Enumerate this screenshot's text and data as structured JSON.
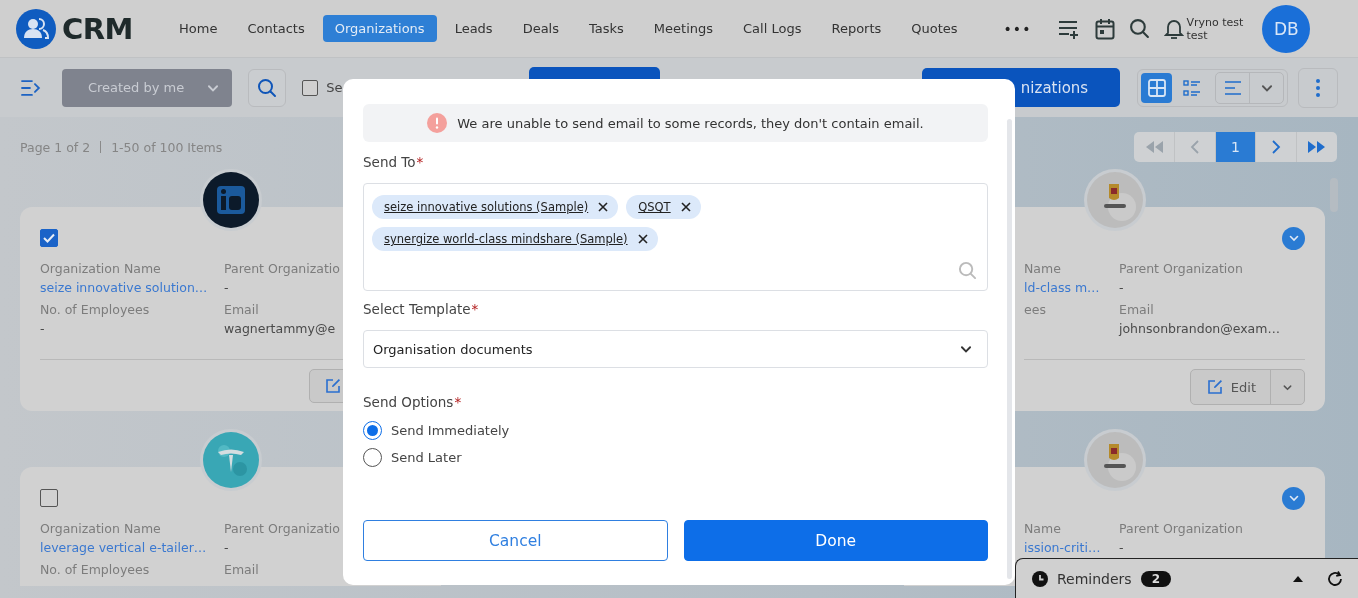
{
  "header": {
    "logo": "CRM",
    "nav": [
      {
        "label": "Home",
        "selected": false
      },
      {
        "label": "Contacts",
        "selected": false
      },
      {
        "label": "Organizations",
        "selected": true
      },
      {
        "label": "Leads",
        "selected": false
      },
      {
        "label": "Deals",
        "selected": false
      },
      {
        "label": "Tasks",
        "selected": false
      },
      {
        "label": "Meetings",
        "selected": false
      },
      {
        "label": "Call Logs",
        "selected": false
      },
      {
        "label": "Reports",
        "selected": false
      },
      {
        "label": "Quotes",
        "selected": false
      }
    ],
    "more": "•••",
    "user": {
      "name": "Vryno test test",
      "initials": "DB"
    }
  },
  "toolbar": {
    "filter": "Created by me",
    "select_all": {
      "label": "Se",
      "checked": false
    },
    "primary_button": "nizations",
    "views": [
      {
        "kind": "grid",
        "selected": true
      },
      {
        "kind": "list",
        "selected": false
      }
    ]
  },
  "summary": {
    "page": "Page 1 of 2",
    "range": "1-50 of 100 Items"
  },
  "pagination": {
    "pages": [
      {
        "label": "1",
        "selected": true
      }
    ]
  },
  "cards": [
    {
      "kind": "selectable",
      "checked": true,
      "footer": true,
      "fields": [
        {
          "label": "Organization Name",
          "value": "seize innovative solution…",
          "link": true
        },
        {
          "label": "Parent Organizatio",
          "value": "-",
          "link": false
        },
        {
          "label": "No. of Employees",
          "value": "-",
          "link": false
        },
        {
          "label": "Email",
          "value": "wagnertammy@e",
          "link": false
        }
      ]
    },
    {
      "kind": "expandable",
      "footer": true,
      "action": "Edit",
      "fields": [
        {
          "label": "Name",
          "value": "ld-class m…",
          "link": true
        },
        {
          "label": "Parent Organization",
          "value": "-",
          "link": false
        },
        {
          "label": "ees"
        },
        {
          "label": "Email",
          "value": "johnsonbrandon@exam…",
          "link": false
        }
      ]
    },
    {
      "kind": "selectable",
      "checked": false,
      "fields": [
        {
          "label": "Organization Name",
          "value": "leverage vertical e-tailer…",
          "link": true
        },
        {
          "label": "Parent Organizatio",
          "value": "-",
          "link": false
        },
        {
          "label": "No. of Employees"
        },
        {
          "label": "Email"
        }
      ]
    },
    {
      "kind": "expandable",
      "fields": [
        {
          "label": "Name",
          "value": "ission-criti…",
          "link": true
        },
        {
          "label": "Parent Organization",
          "value": "-",
          "link": false
        }
      ]
    }
  ],
  "dialog": {
    "alert": "We are unable to send email to some records, they don't contain email.",
    "fields": [
      {
        "kind": "recipients",
        "label": "Send To",
        "required_mark": "*",
        "tags": [
          "seize innovative solutions (Sample)",
          "QSQT",
          "synergize world-class mindshare (Sample)"
        ]
      },
      {
        "kind": "select",
        "label": "Select Template",
        "required_mark": "*",
        "value": "Organisation documents"
      },
      {
        "kind": "radio",
        "label": "Send Options",
        "required_mark": "*",
        "options": [
          {
            "label": "Send Immediately",
            "selected": true
          },
          {
            "label": "Send Later",
            "selected": false
          }
        ]
      }
    ],
    "buttons": [
      {
        "label": "Cancel",
        "kind": "secondary"
      },
      {
        "label": "Done",
        "kind": "primary"
      }
    ]
  },
  "reminders": {
    "label": "Reminders",
    "count": "2"
  }
}
